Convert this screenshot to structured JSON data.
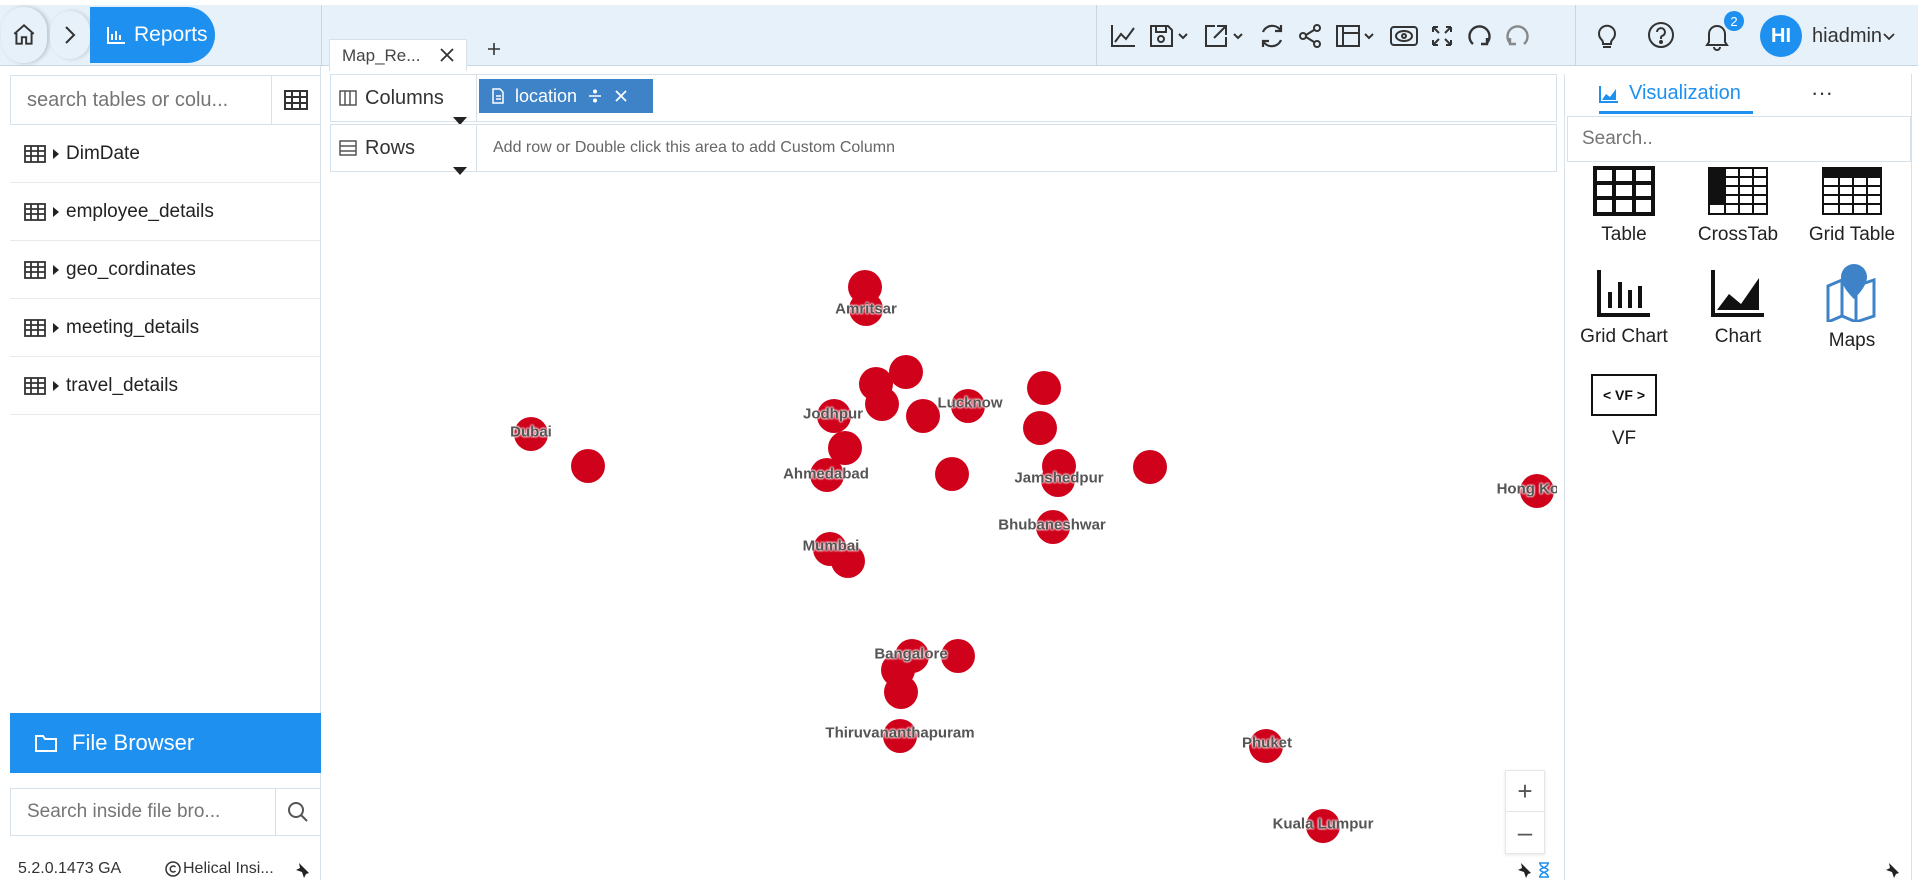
{
  "header": {
    "breadcrumb_label": "Reports",
    "tab_title": "Map_Re...",
    "notification_count": "2",
    "avatar_initials": "HI",
    "username": "hiadmin",
    "toolbar_icons": [
      "line-chart-icon",
      "save-icon",
      "export-icon",
      "refresh-icon",
      "share-icon",
      "layout-icon",
      "preview-icon",
      "fullscreen-icon",
      "undo-icon",
      "redo-icon"
    ]
  },
  "sidebar": {
    "search_placeholder": "search tables or colu...",
    "tables": [
      {
        "label": "DimDate"
      },
      {
        "label": "employee_details"
      },
      {
        "label": "geo_cordinates"
      },
      {
        "label": "meeting_details"
      },
      {
        "label": "travel_details"
      }
    ],
    "file_browser_label": "File Browser",
    "file_search_placeholder": "Search inside file bro...",
    "version": "5.2.0.1473 GA",
    "copyright": "Helical Insi..."
  },
  "shelves": {
    "columns_label": "Columns",
    "rows_label": "Rows",
    "column_pill": "location",
    "rows_hint": "Add row or Double click this area to add Custom Column"
  },
  "map": {
    "marker_color": "#d0021b",
    "labels": [
      "Amritsar",
      "Jodhpur",
      "Lucknow",
      "Dubai",
      "Ahmedabad",
      "Jamshedpur",
      "Hong Kong",
      "Bhubaneshwar",
      "Mumbai",
      "Bangalore",
      "Thiruvananthapuram",
      "Phuket",
      "Kuala Lumpur"
    ],
    "zoom_in": "+",
    "zoom_out": "–"
  },
  "visualization": {
    "tab_label": "Visualization",
    "more_label": "···",
    "search_placeholder": "Search..",
    "items": [
      {
        "label": "Table"
      },
      {
        "label": "CrossTab"
      },
      {
        "label": "Grid Table"
      },
      {
        "label": "Grid Chart"
      },
      {
        "label": "Chart"
      },
      {
        "label": "Maps"
      },
      {
        "label": "VF"
      }
    ],
    "vf_icon_text": "< VF >"
  },
  "colors": {
    "accent": "#1e90f0",
    "topbar_bg": "#e6f1f9",
    "pill": "#3e83c8"
  }
}
